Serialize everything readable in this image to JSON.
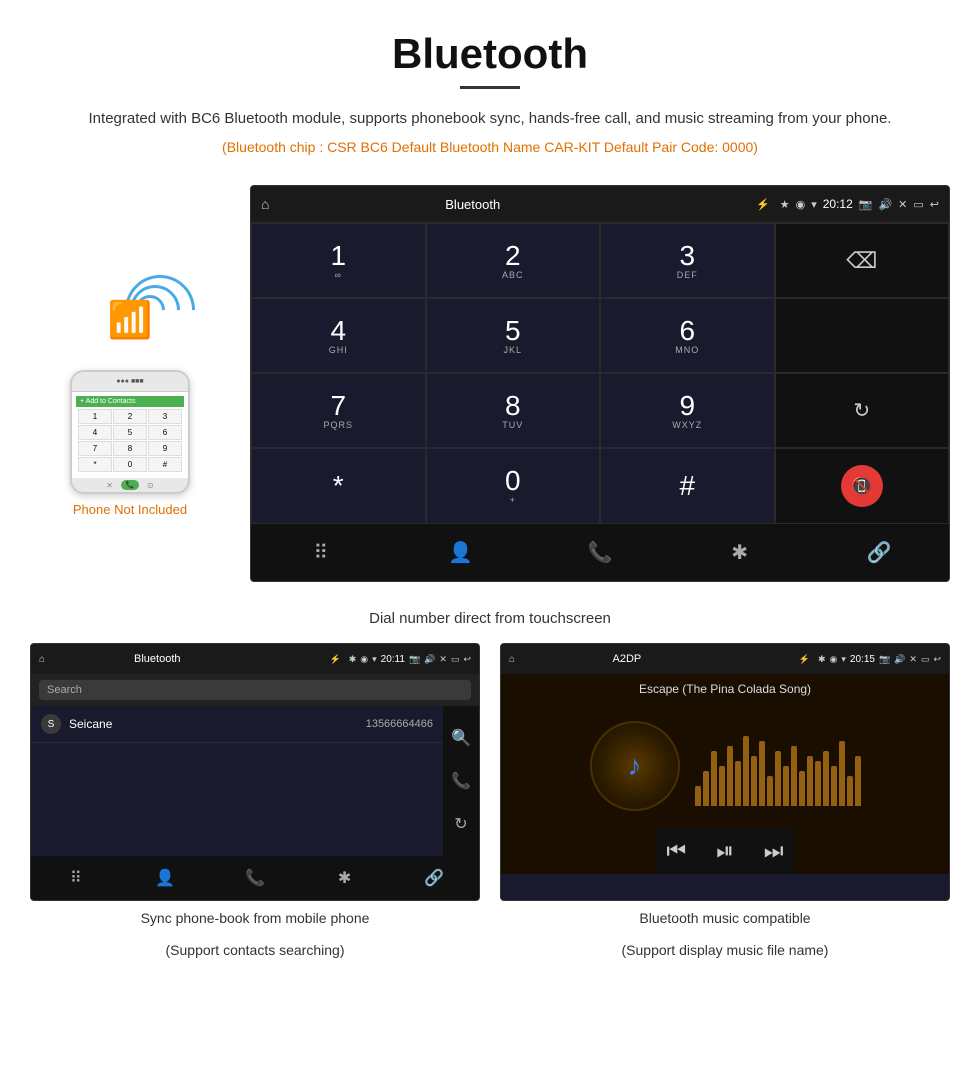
{
  "header": {
    "title": "Bluetooth",
    "description": "Integrated with BC6 Bluetooth module, supports phonebook sync, hands-free call, and music streaming from your phone.",
    "specs": "(Bluetooth chip : CSR BC6    Default Bluetooth Name CAR-KIT    Default Pair Code: 0000)"
  },
  "dialpad": {
    "screen_title": "Bluetooth",
    "time": "20:12",
    "keys": [
      {
        "num": "1",
        "sub": ""
      },
      {
        "num": "2",
        "sub": "ABC"
      },
      {
        "num": "3",
        "sub": "DEF"
      },
      {
        "num": "",
        "sub": ""
      },
      {
        "num": "4",
        "sub": "GHI"
      },
      {
        "num": "5",
        "sub": "JKL"
      },
      {
        "num": "6",
        "sub": "MNO"
      },
      {
        "num": "",
        "sub": ""
      },
      {
        "num": "7",
        "sub": "PQRS"
      },
      {
        "num": "8",
        "sub": "TUV"
      },
      {
        "num": "9",
        "sub": "WXYZ"
      },
      {
        "num": "",
        "sub": ""
      },
      {
        "num": "*",
        "sub": ""
      },
      {
        "num": "0",
        "sub": "+"
      },
      {
        "num": "#",
        "sub": ""
      },
      {
        "num": "",
        "sub": ""
      }
    ],
    "caption": "Dial number direct from touchscreen"
  },
  "phone_not_included": "Phone Not Included",
  "contacts_panel": {
    "title": "Bluetooth",
    "time": "20:11",
    "search_placeholder": "Search",
    "contacts": [
      {
        "initial": "S",
        "name": "Seicane",
        "number": "13566664466"
      }
    ],
    "caption_line1": "Sync phone-book from mobile phone",
    "caption_line2": "(Support contacts searching)"
  },
  "music_panel": {
    "title": "A2DP",
    "time": "20:15",
    "song_title": "Escape (The Pina Colada Song)",
    "caption_line1": "Bluetooth music compatible",
    "caption_line2": "(Support display music file name)"
  },
  "viz_bars": [
    20,
    35,
    55,
    40,
    60,
    45,
    70,
    50,
    65,
    30,
    55,
    40,
    60,
    35,
    50,
    45,
    55,
    40,
    65,
    30,
    50
  ]
}
